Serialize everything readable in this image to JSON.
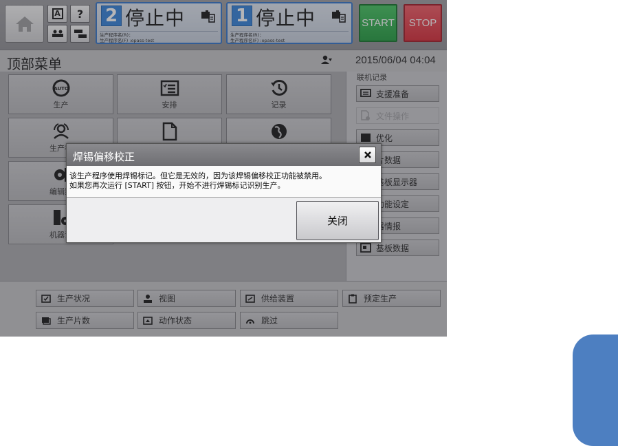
{
  "topbar": {
    "lanes": [
      {
        "number": "2",
        "status": "停止中",
        "program_r": "生产程序名(R)：",
        "program_f": "生产程序名(F) :opass-test"
      },
      {
        "number": "1",
        "status": "停止中",
        "program_r": "生产程序名(R)：",
        "program_f": "生产程序名(F) :opass-test"
      }
    ],
    "small_btn_a": "A",
    "small_btn_help": "?",
    "start_label": "START",
    "stop_label": "STOP",
    "colors": {
      "start": "#27a844",
      "stop": "#e23440",
      "lane_accent": "#2e7fd8"
    }
  },
  "titlebar": {
    "title": "顶部菜单",
    "datetime": "2015/06/04 04:04"
  },
  "grid": {
    "items": [
      {
        "label": "生产",
        "icon": "auto-icon"
      },
      {
        "label": "安排",
        "icon": "checklist-icon"
      },
      {
        "label": "记录",
        "icon": "history-icon"
      },
      {
        "label": "生产补",
        "icon": "person-cycle-icon"
      },
      {
        "label": "",
        "icon": "file-icon"
      },
      {
        "label": "",
        "icon": "globe-icon"
      },
      {
        "label": "编辑数",
        "icon": "gear-edit-icon"
      },
      {
        "label": "机器设",
        "icon": "machine-setting-icon"
      }
    ]
  },
  "rightpanel": {
    "section": "联机记录",
    "items": [
      {
        "label": "支援准备",
        "enabled": true
      },
      {
        "label": "文件操作",
        "enabled": false
      },
      {
        "label": "优化",
        "enabled": true
      },
      {
        "label": "片数据",
        "enabled": true
      },
      {
        "label": "基板显示器",
        "enabled": true
      },
      {
        "label": "功能设定",
        "enabled": true
      },
      {
        "label": "器情报",
        "enabled": true
      },
      {
        "label": "基板数据",
        "enabled": true
      }
    ]
  },
  "bottom": {
    "row1": [
      {
        "label": "生产状况",
        "icon": "check-box-icon"
      },
      {
        "label": "视图",
        "icon": "person-view-icon"
      },
      {
        "label": "供给装置",
        "icon": "feeder-icon"
      },
      {
        "label": "预定生产",
        "icon": "clipboard-icon"
      }
    ],
    "row2": [
      {
        "label": "生产片数",
        "icon": "stack-icon"
      },
      {
        "label": "动作状态",
        "icon": "motion-icon"
      },
      {
        "label": "跳过",
        "icon": "skip-icon"
      }
    ]
  },
  "dialog": {
    "title": "焊锡偏移校正",
    "line1": "该生产程序使用焊锡标记。但它是无效的，因为该焊锡偏移校正功能被禁用。",
    "line2": "如果您再次运行 [START] 按钮，开始不进行焊锡标记识别生产。",
    "close_label": "关闭"
  }
}
